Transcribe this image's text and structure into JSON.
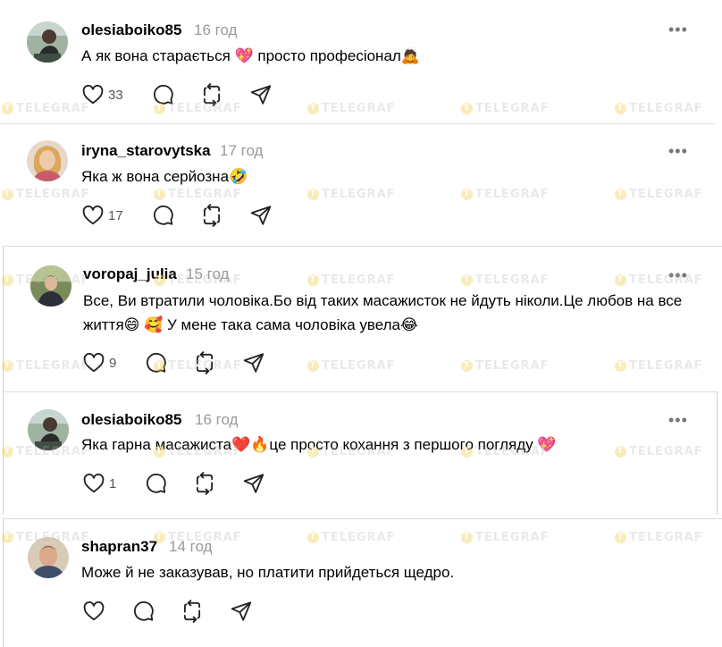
{
  "watermark_text": "TELEGRAF",
  "icons": {
    "more": "more-horizontal-icon",
    "like": "heart-outline-icon",
    "reply": "speech-bubble-icon",
    "repost": "repost-arrows-icon",
    "share": "send-paper-plane-icon"
  },
  "colors": {
    "username": "#000000",
    "time": "#999999",
    "divider": "#dcdcdc",
    "heart_emoji": "#e0245e"
  },
  "comments": [
    {
      "username": "olesiaboiko85",
      "time": "16 год",
      "text": "А як вона старається 💖 просто професіонал🙇",
      "likes": "33"
    },
    {
      "username": "iryna_starovytska",
      "time": "17 год",
      "text": "Яка ж вона серйозна🤣",
      "likes": "17"
    },
    {
      "username": "voropaj_julia",
      "time": "15 год",
      "text": "Все, Ви втратили чоловіка.Бо від таких масажисток не йдуть ніколи.Це любов на все життя😄 🥰 У мене така сама чоловіка увела😂",
      "likes": "9"
    },
    {
      "username": "olesiaboiko85",
      "time": "16 год",
      "text": "Яка гарна масажиста❤️🔥це просто кохання з першого погляду 💖",
      "likes": "1"
    },
    {
      "username": "shapran37",
      "time": "14 год",
      "text": "Може й не заказував, но платити прийдеться щедро.",
      "likes": ""
    }
  ]
}
